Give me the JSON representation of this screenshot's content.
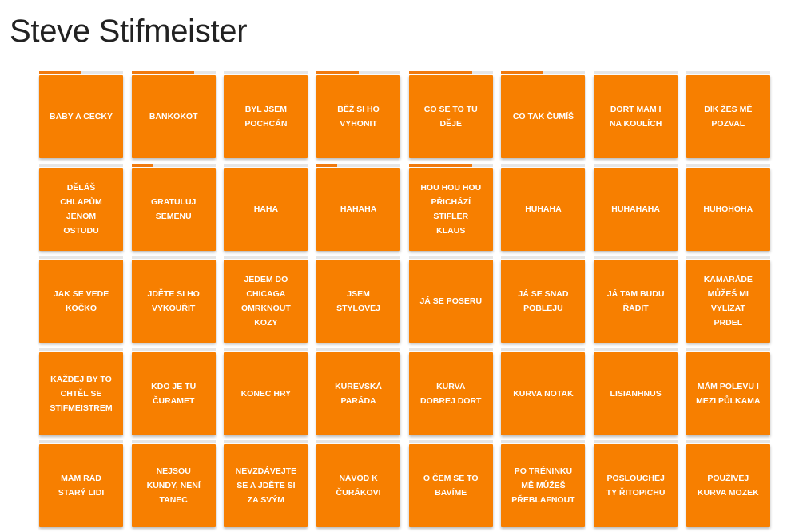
{
  "page": {
    "title": "Steve Stifmeister"
  },
  "colors": {
    "tile": "#f77f00",
    "progress_fill": "#f07a0f",
    "progress_track": "#e6e6e6",
    "tile_text": "#ffffff"
  },
  "sounds": [
    {
      "label": "BABY A CECKY",
      "progress": 0.5
    },
    {
      "label": "BANKOKOT",
      "progress": 0.75
    },
    {
      "label": "BYL JSEM POCHCÁN",
      "progress": 0
    },
    {
      "label": "BĚŽ SI HO VYHONIT",
      "progress": 0.5
    },
    {
      "label": "CO SE TO TU DĚJE",
      "progress": 0.75
    },
    {
      "label": "CO TAK ČUMÍŠ",
      "progress": 0.5
    },
    {
      "label": "DORT MÁM I NA KOULÍCH",
      "progress": 0
    },
    {
      "label": "DÍK ŽES MĚ POZVAL",
      "progress": 0
    },
    {
      "label": "DĚLÁŠ CHLAPŮM JENOM OSTUDU",
      "progress": 0
    },
    {
      "label": "GRATULUJ SEMENU",
      "progress": 0.25
    },
    {
      "label": "HAHA",
      "progress": 0
    },
    {
      "label": "HAHAHA",
      "progress": 0.25
    },
    {
      "label": "HOU HOU HOU PŘICHÁZÍ STIFLER KLAUS",
      "progress": 0.75
    },
    {
      "label": "HUHAHA",
      "progress": 0
    },
    {
      "label": "HUHAHAHA",
      "progress": 0
    },
    {
      "label": "HUHOHOHA",
      "progress": 0
    },
    {
      "label": "JAK SE VEDE KOČKO",
      "progress": 0
    },
    {
      "label": "JDĚTE SI HO VYKOUŘIT",
      "progress": 0
    },
    {
      "label": "JEDEM DO CHICAGA OMRKNOUT KOZY",
      "progress": 0
    },
    {
      "label": "JSEM STYLOVEJ",
      "progress": 0
    },
    {
      "label": "JÁ SE POSERU",
      "progress": 0
    },
    {
      "label": "JÁ SE SNAD POBLEJU",
      "progress": 0
    },
    {
      "label": "JÁ TAM BUDU ŘÁDIT",
      "progress": 0
    },
    {
      "label": "KAMARÁDE MŮŽEŠ MI VYLÍZAT PRDEL",
      "progress": 0
    },
    {
      "label": "KAŽDEJ BY TO CHTĚL SE STIFMEISTREM",
      "progress": 0
    },
    {
      "label": "KDO JE TU ČURAMET",
      "progress": 0
    },
    {
      "label": "KONEC HRY",
      "progress": 0
    },
    {
      "label": "KUREVSKÁ PARÁDA",
      "progress": 0
    },
    {
      "label": "KURVA DOBREJ DORT",
      "progress": 0
    },
    {
      "label": "KURVA NOTAK",
      "progress": 0
    },
    {
      "label": "LISIANHNUS",
      "progress": 0
    },
    {
      "label": "MÁM POLEVU I MEZI PŮLKAMA",
      "progress": 0
    },
    {
      "label": "MÁM RÁD STARÝ LIDI",
      "progress": 0
    },
    {
      "label": "NEJSOU KUNDY, NENÍ TANEC",
      "progress": 0
    },
    {
      "label": "NEVZDÁVEJTE SE A JDĚTE SI ZA SVÝM",
      "progress": 0
    },
    {
      "label": "NÁVOD K ČURÁKOVI",
      "progress": 0
    },
    {
      "label": "O ČEM SE TO BAVÍME",
      "progress": 0
    },
    {
      "label": "PO TRÉNINKU MĚ MŮŽEŠ PŘEBLAFNOUT",
      "progress": 0
    },
    {
      "label": "POSLOUCHEJ TY ŘITOPICHU",
      "progress": 0
    },
    {
      "label": "POUŽÍVEJ KURVA MOZEK",
      "progress": 0
    }
  ]
}
